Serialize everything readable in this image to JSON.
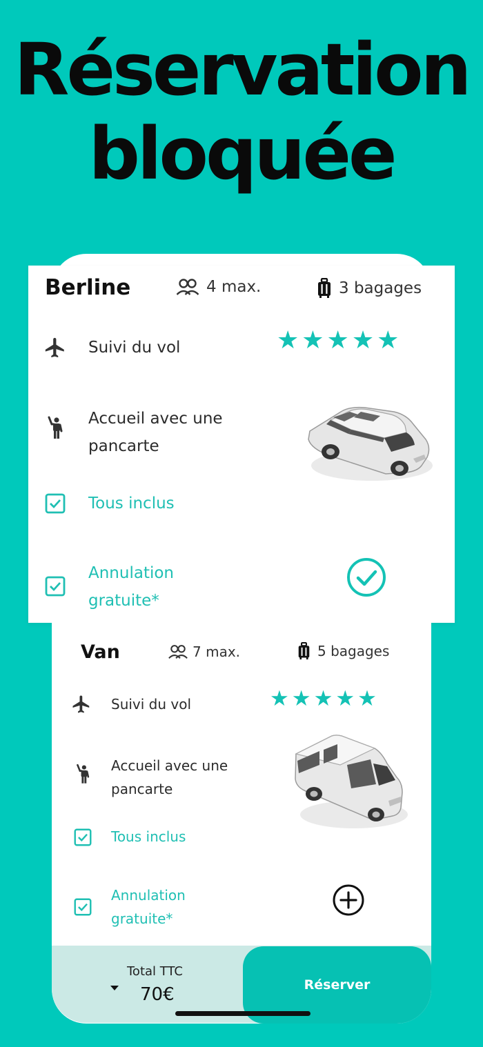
{
  "headline": {
    "line1": "Réservation",
    "line2": "bloquée"
  },
  "berline": {
    "title": "Berline",
    "passengers": "4 max.",
    "luggage": "3 bagages",
    "stars": "★★★★★",
    "rating": 5,
    "features": {
      "flight": "Suivi du vol",
      "welcome_line1": "Accueil avec une",
      "welcome_line2": "pancarte",
      "included": "Tous inclus",
      "cancel_line1": "Annulation",
      "cancel_line2": "gratuite*"
    },
    "selected": true
  },
  "van": {
    "title": "Van",
    "passengers": "7 max.",
    "luggage": "5 bagages",
    "stars": "★★★★★",
    "rating": 5,
    "features": {
      "flight": "Suivi du vol",
      "welcome_line1": "Accueil avec une",
      "welcome_line2": "pancarte",
      "included": "Tous inclus",
      "cancel_line1": "Annulation",
      "cancel_line2": "gratuite*"
    },
    "selected": false
  },
  "footer": {
    "total_label": "Total TTC",
    "total_value": "70€",
    "reserve_label": "Réserver"
  },
  "colors": {
    "background": "#00c9bb",
    "accent": "#14c2b5",
    "footer_bg": "#cbe9e5"
  }
}
